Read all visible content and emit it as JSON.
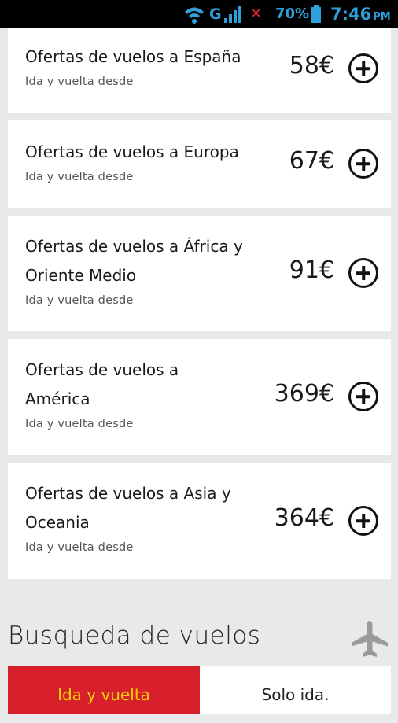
{
  "status_bar": {
    "network": "G",
    "battery_percent": "70%",
    "time": "7:46",
    "ampm": "PM",
    "accent_color": "#2e9fd8"
  },
  "offers": [
    {
      "title": "Ofertas de vuelos a España",
      "subtitle": "Ida y vuelta desde",
      "price": "58€"
    },
    {
      "title": "Ofertas de vuelos a Europa",
      "subtitle": "Ida y vuelta desde",
      "price": "67€"
    },
    {
      "title": "Ofertas de vuelos a África y Oriente Medio",
      "subtitle": "Ida y vuelta desde",
      "price": "91€"
    },
    {
      "title": "Ofertas de vuelos a América",
      "subtitle": "Ida y vuelta desde",
      "price": "369€"
    },
    {
      "title": "Ofertas de vuelos a Asia y Oceania",
      "subtitle": "Ida y vuelta desde",
      "price": "364€"
    }
  ],
  "search": {
    "title": "Busqueda de vuelos",
    "icon": "airplane-icon",
    "tabs": [
      {
        "label": "Ida y vuelta",
        "active": true
      },
      {
        "label": "Solo ida.",
        "active": false
      }
    ],
    "active_tab_color": "#d81f2c",
    "active_tab_text_color": "#f5d300"
  }
}
